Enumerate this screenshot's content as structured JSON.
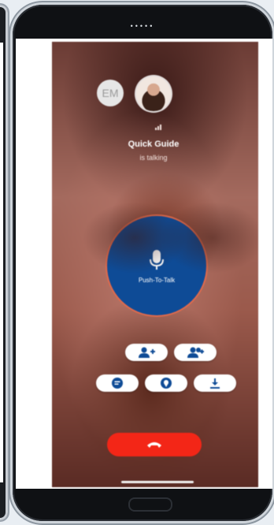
{
  "caller": {
    "name": "Quick Guide",
    "status": "is talking"
  },
  "avatars": {
    "initials": "EM"
  },
  "ptt": {
    "label": "Push-To-Talk"
  },
  "actions": [
    {
      "icon": "add-contact-icon"
    },
    {
      "icon": "add-group-icon"
    },
    {
      "icon": "message-icon"
    },
    {
      "icon": "map-pin-icon"
    },
    {
      "icon": "download-icon"
    }
  ],
  "colors": {
    "accent_blue": "#0e4b96",
    "end_call_red": "#f32617",
    "ring_orange": "#e06a4c"
  }
}
